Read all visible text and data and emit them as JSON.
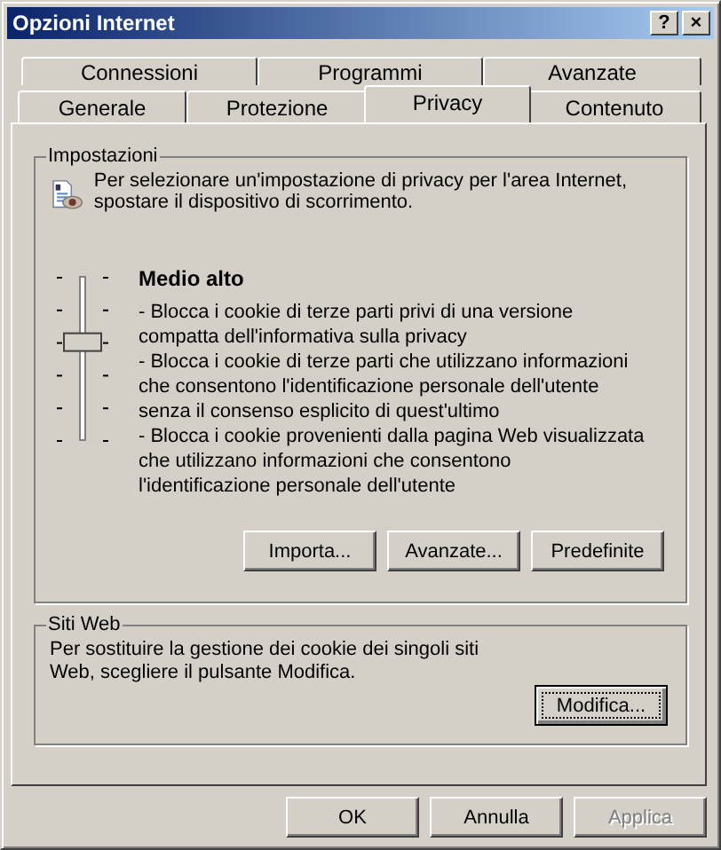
{
  "window": {
    "title": "Opzioni Internet",
    "title_buttons": [
      "?",
      "×"
    ]
  },
  "tab_rows": [
    [
      {
        "label": "Connessioni",
        "selected": false
      },
      {
        "label": "Programmi",
        "selected": false
      },
      {
        "label": "Avanzate",
        "selected": false
      }
    ],
    [
      {
        "label": "Generale",
        "selected": false
      },
      {
        "label": "Protezione",
        "selected": false
      },
      {
        "label": "Privacy",
        "selected": true
      },
      {
        "label": "Contenuto",
        "selected": false
      }
    ]
  ],
  "settings": {
    "title": "Impostazioni",
    "intro": "Per selezionare un'impostazione di privacy per l'area Internet, spostare il dispositivo di scorrimento.",
    "slider": {
      "level": 0.6
    },
    "level_name": "Medio alto",
    "details": [
      "- Blocca i cookie di terze parti privi di una versione compatta dell'informativa sulla privacy",
      "- Blocca i cookie di terze parti che utilizzano informazioni che consentono l'identificazione personale dell'utente senza il consenso esplicito di quest'ultimo",
      "- Blocca i cookie provenienti dalla pagina Web visualizzata che utilizzano informazioni che consentono l'identificazione personale dell'utente"
    ],
    "buttons": [
      "Importa...",
      "Avanzate...",
      "Predefinite"
    ]
  },
  "websites": {
    "title": "Siti Web",
    "text": "Per sostituire la gestione dei cookie dei singoli siti Web, scegliere il pulsante Modifica.",
    "button": {
      "label": "Modifica...",
      "focused": true
    }
  },
  "dialog_buttons": [
    {
      "label": "OK",
      "disabled": false
    },
    {
      "label": "Annulla",
      "disabled": false
    },
    {
      "label": "Applica",
      "disabled": true
    }
  ]
}
